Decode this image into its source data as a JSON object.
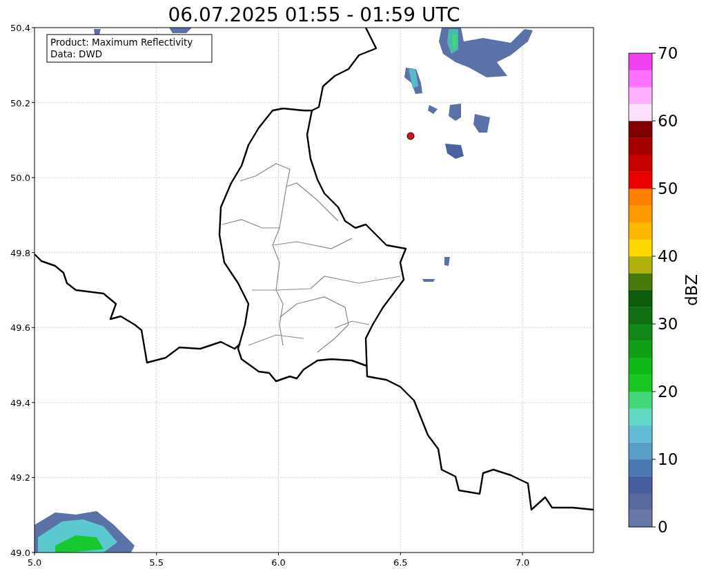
{
  "title": "06.07.2025 01:55 - 01:59 UTC",
  "legend": [
    "Product: Maximum Reflectivity",
    "Data: DWD"
  ],
  "map": {
    "xticks": [
      "5.0",
      "5.5",
      "6.0",
      "6.5",
      "7.0"
    ],
    "yticks": [
      "50.4",
      "50.2",
      "50.0",
      "49.8",
      "49.6",
      "49.4",
      "49.2",
      "49.0"
    ]
  },
  "colorbar": {
    "label": "dBZ",
    "ticks": [
      "70",
      "60",
      "50",
      "40",
      "30",
      "20",
      "10",
      "0"
    ],
    "colors": [
      {
        "color": "#6677a8"
      },
      {
        "color": "#566a9f"
      },
      {
        "color": "#455f9f"
      },
      {
        "color": "#4a78b0"
      },
      {
        "color": "#5a9ec8"
      },
      {
        "color": "#60bcd8"
      },
      {
        "color": "#60d8c8"
      },
      {
        "color": "#40d878"
      },
      {
        "color": "#18c820"
      },
      {
        "color": "#10b818"
      },
      {
        "color": "#10a018"
      },
      {
        "color": "#108818"
      },
      {
        "color": "#107010"
      },
      {
        "color": "#0c5c0c"
      },
      {
        "color": "#4a7a0a"
      },
      {
        "color": "#b0b00a"
      },
      {
        "color": "#ffd800"
      },
      {
        "color": "#ffb800"
      },
      {
        "color": "#ff9a00"
      },
      {
        "color": "#ff7f00"
      },
      {
        "color": "#e80000"
      },
      {
        "color": "#c80000"
      },
      {
        "color": "#a40000"
      },
      {
        "color": "#800000"
      },
      {
        "color": "#ffe0ff"
      },
      {
        "color": "#ffb0ff"
      },
      {
        "color": "#ff70ff"
      },
      {
        "color": "#f040f0"
      }
    ]
  }
}
